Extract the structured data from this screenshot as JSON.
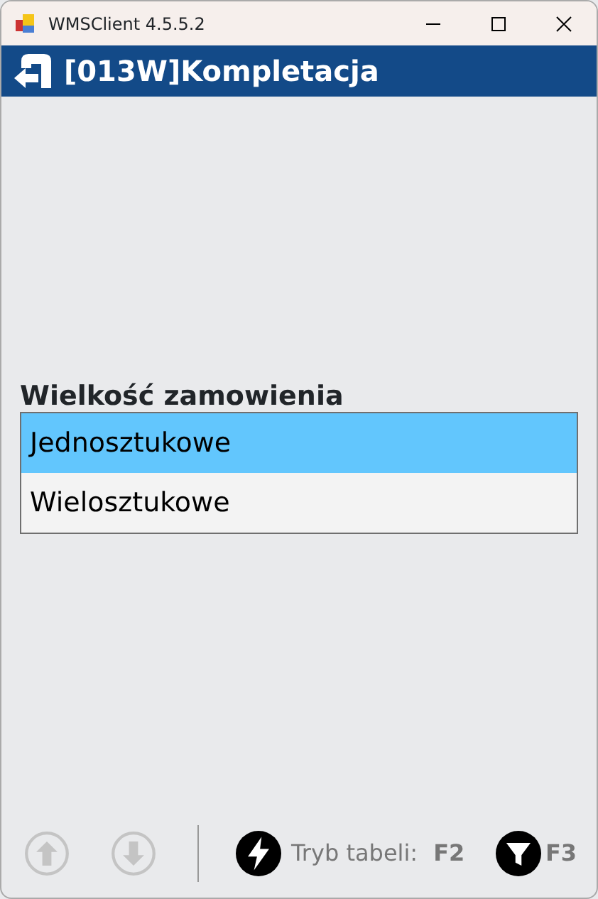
{
  "window": {
    "title": "WMSClient 4.5.5.2"
  },
  "header": {
    "title": "[013W]Kompletacja"
  },
  "field": {
    "label": "Wielkość zamowienia",
    "options": [
      {
        "label": "Jednosztukowe",
        "selected": true
      },
      {
        "label": "Wielosztukowe",
        "selected": false
      }
    ]
  },
  "toolbar": {
    "nav_buttons": [
      {
        "kind": "up",
        "disabled": true
      },
      {
        "kind": "down",
        "disabled": true
      }
    ],
    "table_mode": {
      "label": "Tryb tabeli:",
      "key": "F2"
    },
    "filter": {
      "key": "F3"
    }
  }
}
